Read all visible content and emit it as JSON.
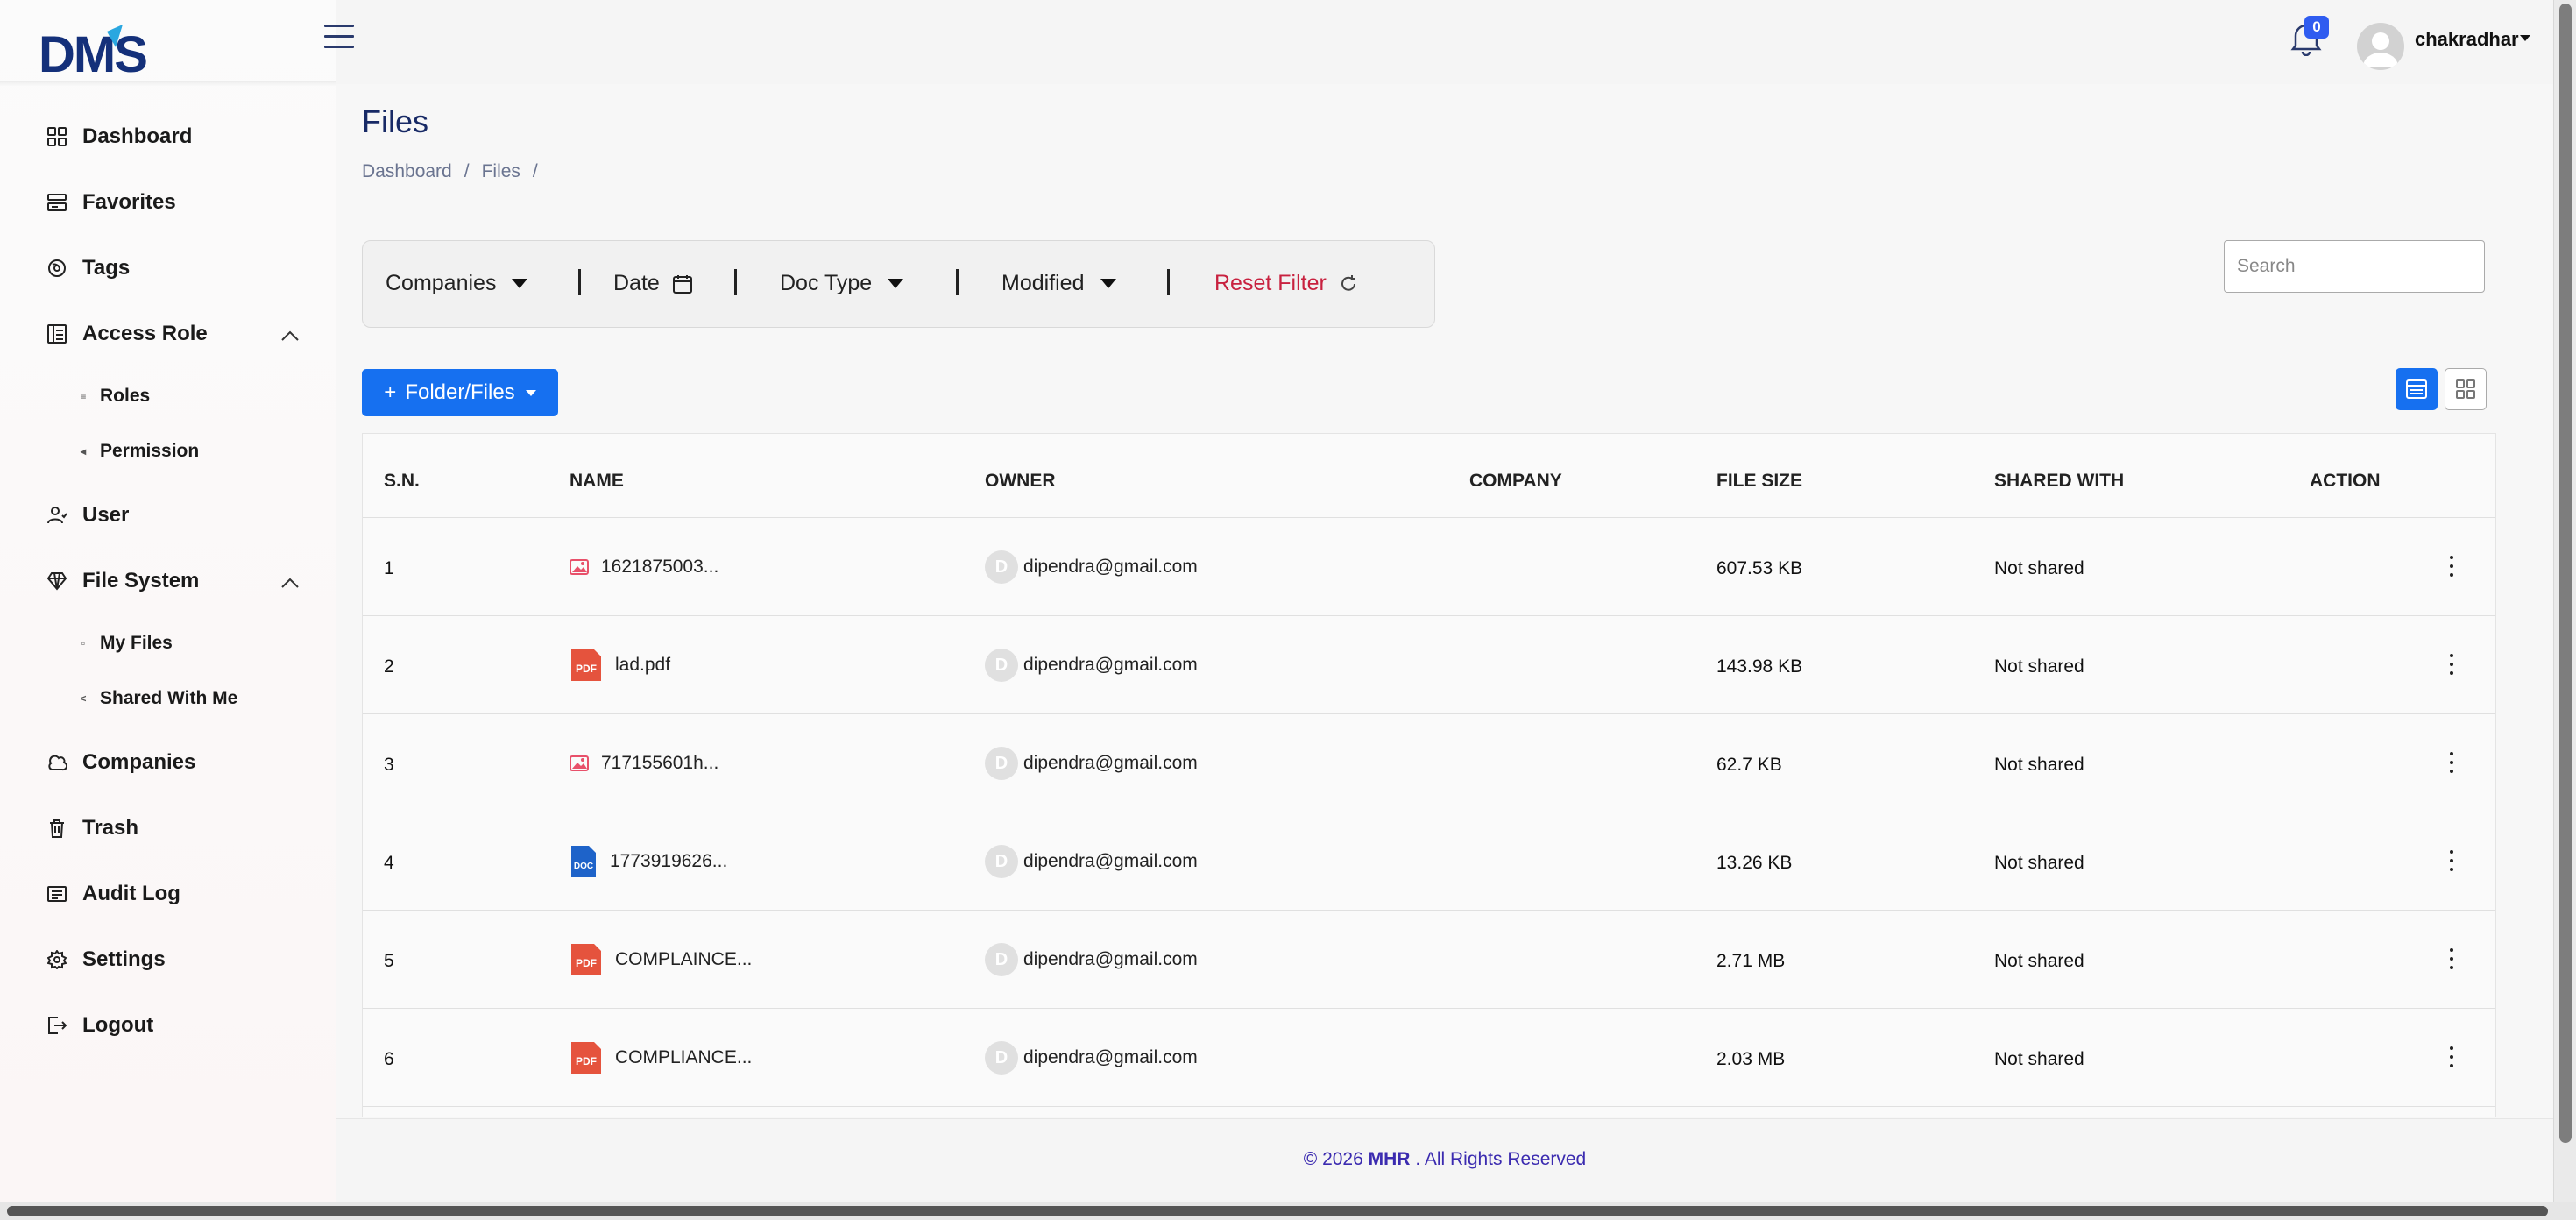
{
  "brand": {
    "logo_text": "DMS"
  },
  "colors": {
    "primary": "#1670f0",
    "title": "#182a66",
    "reset": "#c8213f",
    "footer": "#3b2bb0"
  },
  "header": {
    "notification_count": "0",
    "username": "chakradhar"
  },
  "sidebar": {
    "items": [
      {
        "label": "Dashboard",
        "icon": "dashboard-icon"
      },
      {
        "label": "Favorites",
        "icon": "favorites-icon"
      },
      {
        "label": "Tags",
        "icon": "tag-icon"
      },
      {
        "label": "Access Role",
        "icon": "access-role-icon"
      },
      {
        "label": "Roles",
        "icon": "roles-icon"
      },
      {
        "label": "Permission",
        "icon": "permission-icon"
      },
      {
        "label": "User",
        "icon": "user-icon"
      },
      {
        "label": "File System",
        "icon": "file-system-icon"
      },
      {
        "label": "My Files",
        "icon": "my-files-icon"
      },
      {
        "label": "Shared With Me",
        "icon": "share-icon"
      },
      {
        "label": "Companies",
        "icon": "companies-icon"
      },
      {
        "label": "Trash",
        "icon": "trash-icon"
      },
      {
        "label": "Audit Log",
        "icon": "audit-log-icon"
      },
      {
        "label": "Settings",
        "icon": "gear-icon"
      },
      {
        "label": "Logout",
        "icon": "logout-icon"
      }
    ]
  },
  "page": {
    "title": "Files",
    "breadcrumb": [
      "Dashboard",
      "Files"
    ],
    "breadcrumb_sep": "/"
  },
  "filters": {
    "companies": "Companies",
    "date": "Date",
    "doc_type": "Doc Type",
    "modified": "Modified",
    "reset": "Reset Filter"
  },
  "search": {
    "placeholder": "Search",
    "value": ""
  },
  "actions": {
    "add_label": "Folder/Files",
    "add_prefix": "+"
  },
  "table": {
    "columns": [
      "S.N.",
      "NAME",
      "OWNER",
      "COMPANY",
      "FILE SIZE",
      "SHARED WITH",
      "ACTION"
    ],
    "rows": [
      {
        "sn": "1",
        "name": "1621875003...",
        "type": "image",
        "owner_initial": "D",
        "owner": "dipendra@gmail.com",
        "company": "",
        "size": "607.53 KB",
        "shared": "Not shared"
      },
      {
        "sn": "2",
        "name": "lad.pdf",
        "type": "pdf",
        "owner_initial": "D",
        "owner": "dipendra@gmail.com",
        "company": "",
        "size": "143.98 KB",
        "shared": "Not shared"
      },
      {
        "sn": "3",
        "name": "717155601h...",
        "type": "image",
        "owner_initial": "D",
        "owner": "dipendra@gmail.com",
        "company": "",
        "size": "62.7 KB",
        "shared": "Not shared"
      },
      {
        "sn": "4",
        "name": "1773919626...",
        "type": "doc",
        "owner_initial": "D",
        "owner": "dipendra@gmail.com",
        "company": "",
        "size": "13.26 KB",
        "shared": "Not shared"
      },
      {
        "sn": "5",
        "name": "COMPLAINCE...",
        "type": "pdf",
        "owner_initial": "D",
        "owner": "dipendra@gmail.com",
        "company": "",
        "size": "2.71 MB",
        "shared": "Not shared"
      },
      {
        "sn": "6",
        "name": "COMPLIANCE...",
        "type": "pdf",
        "owner_initial": "D",
        "owner": "dipendra@gmail.com",
        "company": "",
        "size": "2.03 MB",
        "shared": "Not shared"
      }
    ]
  },
  "footer": {
    "prefix": "© 2026",
    "brand": "MHR",
    "suffix": ". All Rights Reserved"
  }
}
